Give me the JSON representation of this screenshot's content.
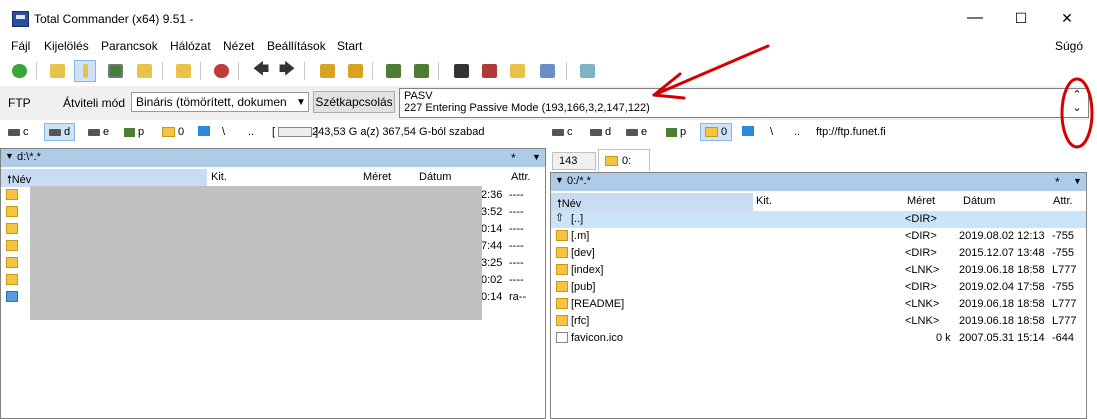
{
  "window": {
    "title": "Total Commander (x64) 9.51 -",
    "minimize": "—",
    "maximize": "☐",
    "close": "✕"
  },
  "menu": {
    "items": [
      "Fájl",
      "Kijelölés",
      "Parancsok",
      "Hálózat",
      "Nézet",
      "Beállítások",
      "Start"
    ],
    "help": "Súgó"
  },
  "ftp": {
    "label": "FTP",
    "mode_label": "Átviteli mód",
    "mode_value": "Bináris (tömörített, dokumen",
    "disconnect": "Szétkapcsolás",
    "log": [
      "PASV",
      "227 Entering Passive Mode (193,166,3,2,147,122)"
    ],
    "scroll_up": "⌃",
    "scroll_down": "⌄"
  },
  "left_drives": {
    "c": "c",
    "d": "d",
    "e": "e",
    "p": "p",
    "zero": "0",
    "back": "\\",
    "up": "..",
    "free": "243,53 G a(z) 367,54 G-ból szabad"
  },
  "right_drives": {
    "c": "c",
    "d": "d",
    "e": "e",
    "p": "p",
    "zero": "0",
    "back": "\\",
    "up": "..",
    "path": "ftp://ftp.funet.fi"
  },
  "left_panel": {
    "path": "d:\\*.*",
    "star": "*",
    "columns": {
      "name": "Név",
      "ext": "Kit.",
      "size": "Méret",
      "date": "Dátum",
      "attr": "Attr."
    },
    "rows": [
      {
        "date": "2:36",
        "attr": "----"
      },
      {
        "date": "3:52",
        "attr": "----"
      },
      {
        "date": "0:14",
        "attr": "----"
      },
      {
        "date": "7:44",
        "attr": "----"
      },
      {
        "date": "3:25",
        "attr": "----"
      },
      {
        "date": "0:02",
        "attr": "----"
      },
      {
        "date": "0:14",
        "attr": "ra--"
      }
    ]
  },
  "right_panel": {
    "tabs": [
      "143",
      "0:"
    ],
    "path": "0:/*.*",
    "star": "*",
    "columns": {
      "name": "Név",
      "ext": "Kit.",
      "size": "Méret",
      "date": "Dátum",
      "attr": "Attr."
    },
    "rows": [
      {
        "name": "[..]",
        "size": "<DIR>",
        "date": "",
        "attr": ""
      },
      {
        "name": "[.m]",
        "size": "<DIR>",
        "date": "2019.08.02 12:13",
        "attr": "-755"
      },
      {
        "name": "[dev]",
        "size": "<DIR>",
        "date": "2015.12.07 13:48",
        "attr": "-755"
      },
      {
        "name": "[index]",
        "size": "<LNK>",
        "date": "2019.06.18 18:58",
        "attr": "L777"
      },
      {
        "name": "[pub]",
        "size": "<DIR>",
        "date": "2019.02.04 17:58",
        "attr": "-755"
      },
      {
        "name": "[README]",
        "size": "<LNK>",
        "date": "2019.06.18 18:58",
        "attr": "L777"
      },
      {
        "name": "[rfc]",
        "size": "<LNK>",
        "date": "2019.06.18 18:58",
        "attr": "L777"
      },
      {
        "name": "favicon.ico",
        "size": "0 k",
        "date": "2007.05.31 15:14",
        "attr": "-644"
      }
    ]
  }
}
